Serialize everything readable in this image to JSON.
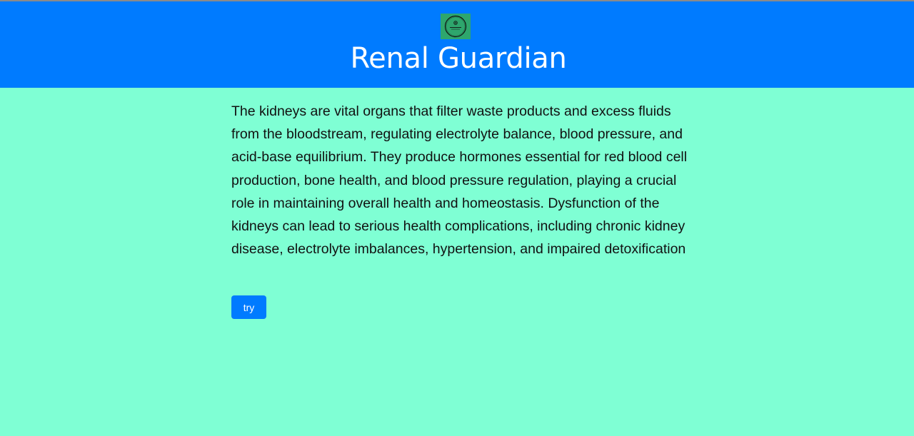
{
  "header": {
    "title": "Renal Guardian",
    "background_color": "#007bff",
    "logo": {
      "icon": "kidney-logo-icon",
      "background_color": "#2ea66d"
    }
  },
  "main": {
    "background_color": "#7fffd4",
    "description": "The kidneys are vital organs that filter waste products and excess fluids from the bloodstream, regulating electrolyte balance, blood pressure, and acid-base equilibrium. They produce hormones essential for red blood cell production, bone health, and blood pressure regulation, playing a crucial role in maintaining overall health and homeostasis. Dysfunction of the kidneys can lead to serious health complications, including chronic kidney disease, electrolyte imbalances, hypertension, and impaired detoxification",
    "try_button_label": "try"
  }
}
